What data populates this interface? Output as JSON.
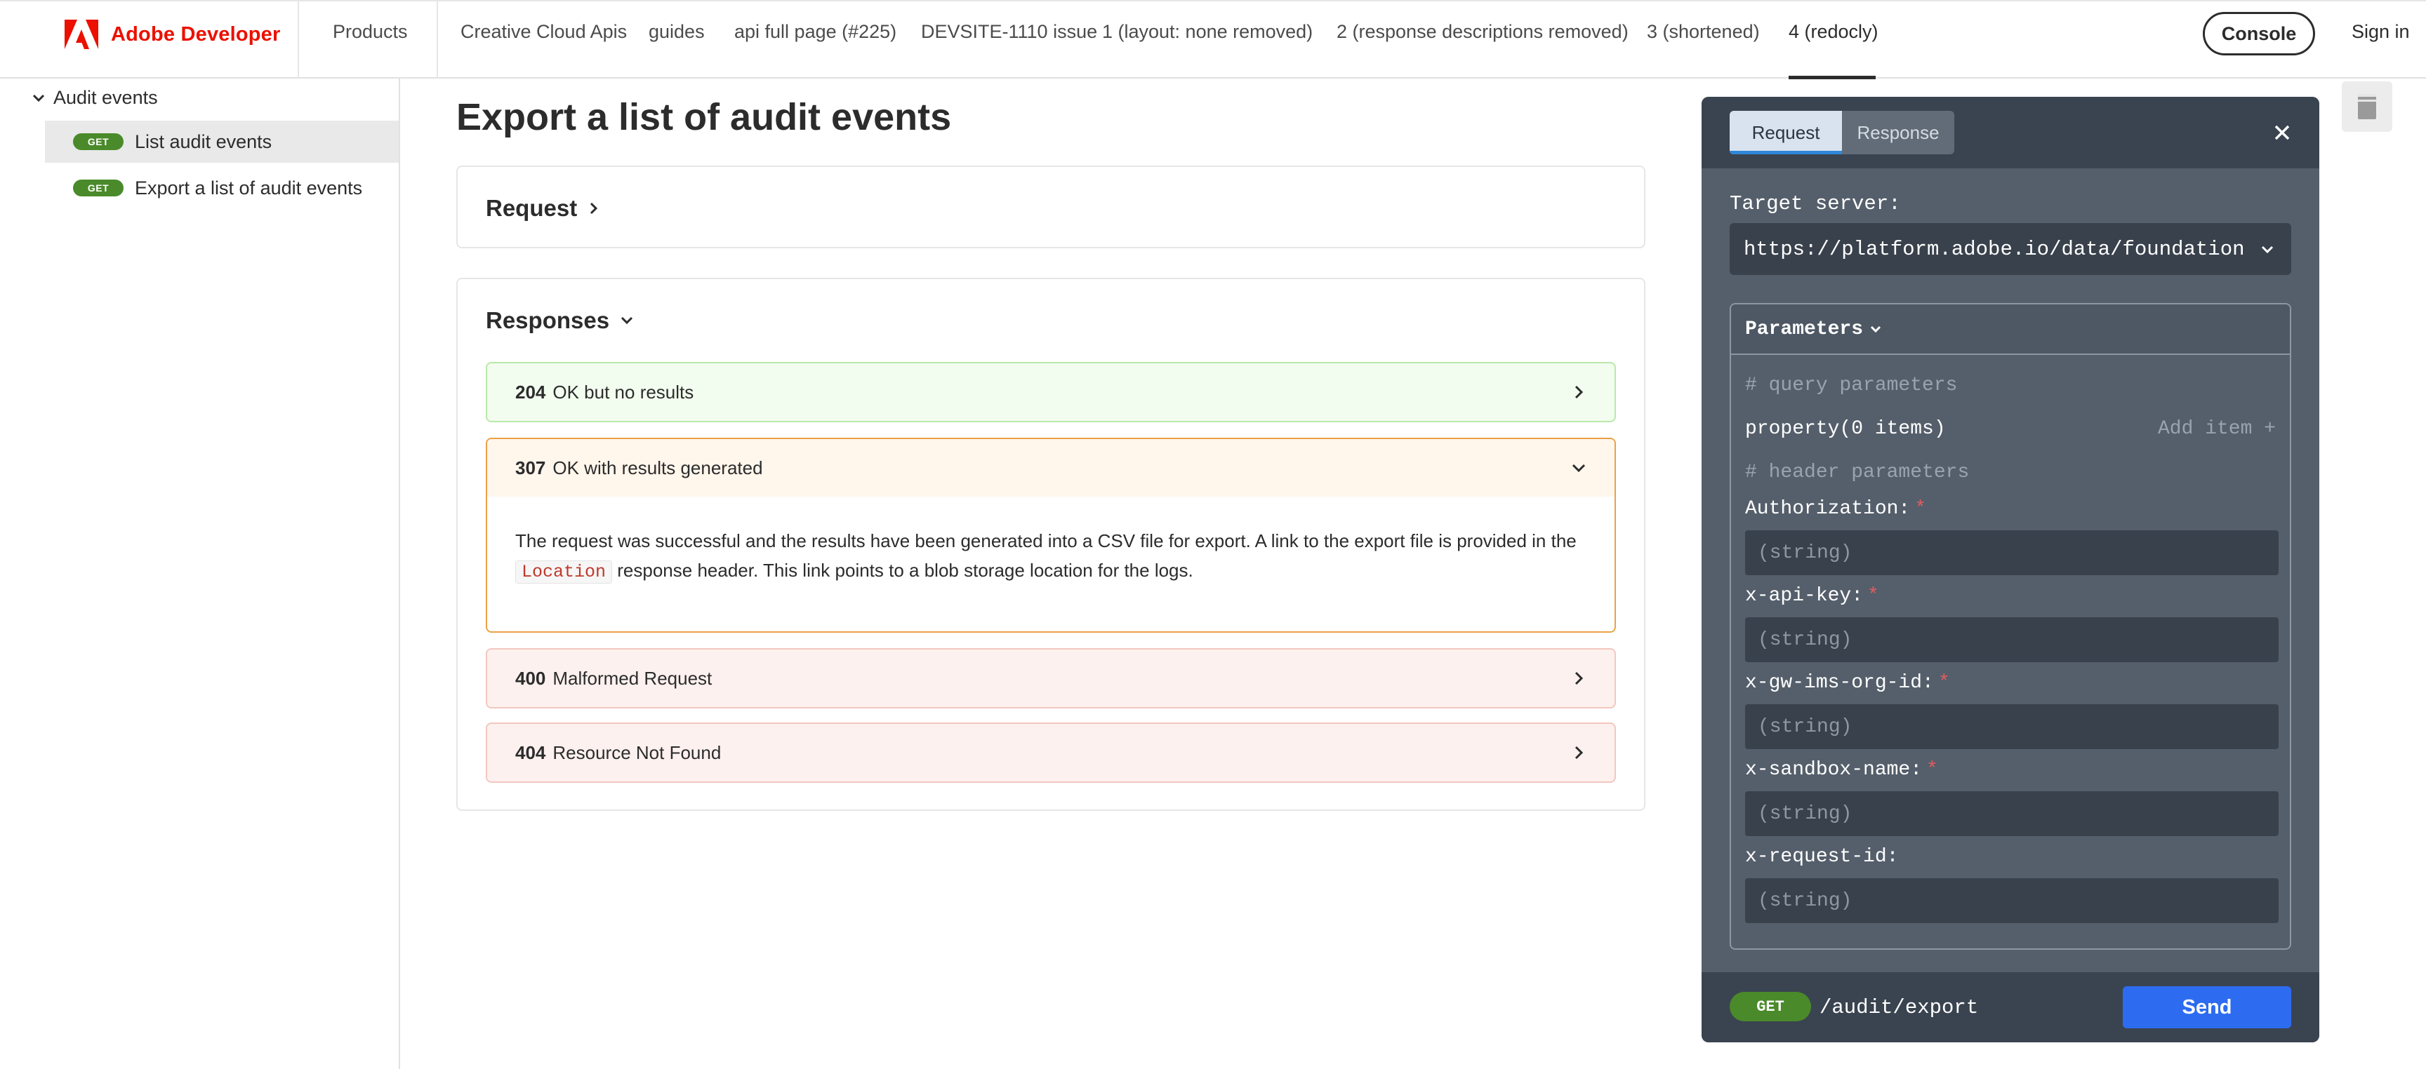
{
  "nav": {
    "brand": "Adobe Developer",
    "products": "Products",
    "links": [
      "Creative Cloud Apis",
      "guides",
      "api full page (#225)",
      "DEVSITE-1110 issue",
      "1 (layout: none removed)",
      "2 (response descriptions removed)",
      "3 (shortened)",
      "4 (redocly)"
    ],
    "active_link": "4 (redocly)",
    "console": "Console",
    "signin": "Sign in"
  },
  "sidebar": {
    "group": "Audit events",
    "items": [
      {
        "method": "GET",
        "label": "List audit events",
        "selected": true
      },
      {
        "method": "GET",
        "label": "Export a list of audit events",
        "selected": false
      }
    ]
  },
  "main": {
    "title": "Export a list of audit events",
    "request_label": "Request",
    "responses_label": "Responses",
    "responses": [
      {
        "code": "204",
        "text": "OK but no results",
        "expanded": false
      },
      {
        "code": "307",
        "text": "OK with results generated",
        "expanded": true,
        "desc_before": "The request was successful and the results have been generated into a CSV file for export. A link to the export file is provided in the",
        "desc_code": "Location",
        "desc_after": "response header. This link points to a blob storage location for the logs."
      },
      {
        "code": "400",
        "text": "Malformed Request",
        "expanded": false
      },
      {
        "code": "404",
        "text": "Resource Not Found",
        "expanded": false
      }
    ]
  },
  "panel": {
    "tabs": [
      "Request",
      "Response"
    ],
    "active_tab": "Request",
    "target_label": "Target server:",
    "server": "https://platform.adobe.io/data/foundation",
    "params_label": "Parameters",
    "query_comment": "# query parameters",
    "property": "property(0 items)",
    "add_item": "Add item +",
    "header_comment": "# header parameters",
    "fields": [
      {
        "name": "Authorization:",
        "required": true,
        "placeholder": "(string)"
      },
      {
        "name": "x-api-key:",
        "required": true,
        "placeholder": "(string)"
      },
      {
        "name": "x-gw-ims-org-id:",
        "required": true,
        "placeholder": "(string)"
      },
      {
        "name": "x-sandbox-name:",
        "required": true,
        "placeholder": "(string)"
      },
      {
        "name": "x-request-id:",
        "required": false,
        "placeholder": "(string)"
      }
    ],
    "required_mark": "*",
    "method": "GET",
    "path": "/audit/export",
    "send": "Send"
  },
  "colors": {
    "brand": "#eb1000",
    "get_badge": "#4a8a2a",
    "send": "#2d6cf0",
    "ok_bg": "#f2fdef",
    "redirect_border": "#eba146",
    "error_bg": "#fdf1ef"
  }
}
